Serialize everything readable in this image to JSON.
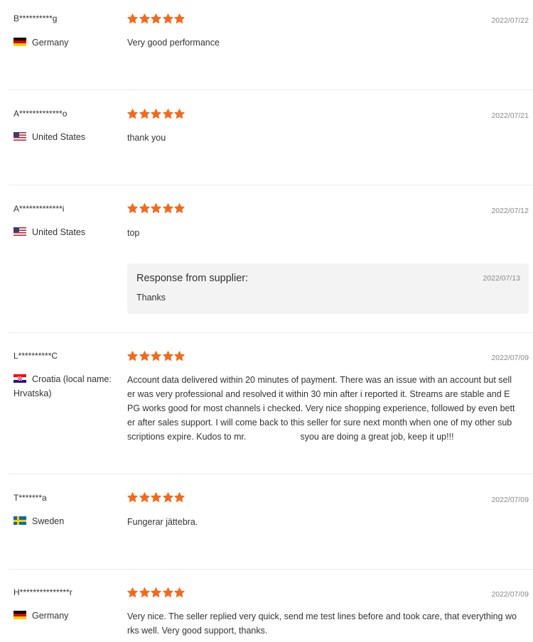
{
  "star_color": "#f26a1b",
  "reviews": [
    {
      "user": "B**********g",
      "flag": "germany-flag-icon",
      "country": "Germany",
      "stars": 5,
      "date": "2022/07/22",
      "comment": "Very good performance"
    },
    {
      "user": "A*************o",
      "flag": "usa-flag-icon",
      "country": "United States",
      "stars": 5,
      "date": "2022/07/21",
      "comment": "thank you"
    },
    {
      "user": "A*************i",
      "flag": "usa-flag-icon",
      "country": "United States",
      "stars": 5,
      "date": "2022/07/12",
      "comment": "top",
      "response": {
        "title": "Response from supplier:",
        "date": "2022/07/13",
        "text": "Thanks"
      }
    },
    {
      "user": "L**********C",
      "flag": "croatia-flag-icon",
      "country": "Croatia (local name: Hrvatska)",
      "stars": 5,
      "date": "2022/07/09",
      "comment_line1": "Account data delivered within 20 minutes of payment. There was an issue with an account but sell",
      "comment_line2": "er was very professional and resolved it within 30 min after i reported it. Streams are stable and E",
      "comment_line3": "PG works good for most channels i checked. Very nice shopping experience, followed by even bett",
      "comment_line4": "er after sales support. I will come back to this seller for sure next month when one of my other sub",
      "comment_line5a": "scriptions expire. Kudos to mr.",
      "comment_line5b": "syou are doing a great job, keep it up!!!"
    },
    {
      "user": "T*******a",
      "flag": "sweden-flag-icon",
      "country": "Sweden",
      "stars": 5,
      "date": "2022/07/09",
      "comment": "Fungerar jättebra."
    },
    {
      "user": "H***************r",
      "flag": "germany-flag-icon",
      "country": "Germany",
      "stars": 5,
      "date": "2022/07/09",
      "comment_line1": "Very nice. The seller replied very quick, send me test lines before and took care, that everything wo",
      "comment_line2": "rks well. Very good support, thanks."
    }
  ]
}
